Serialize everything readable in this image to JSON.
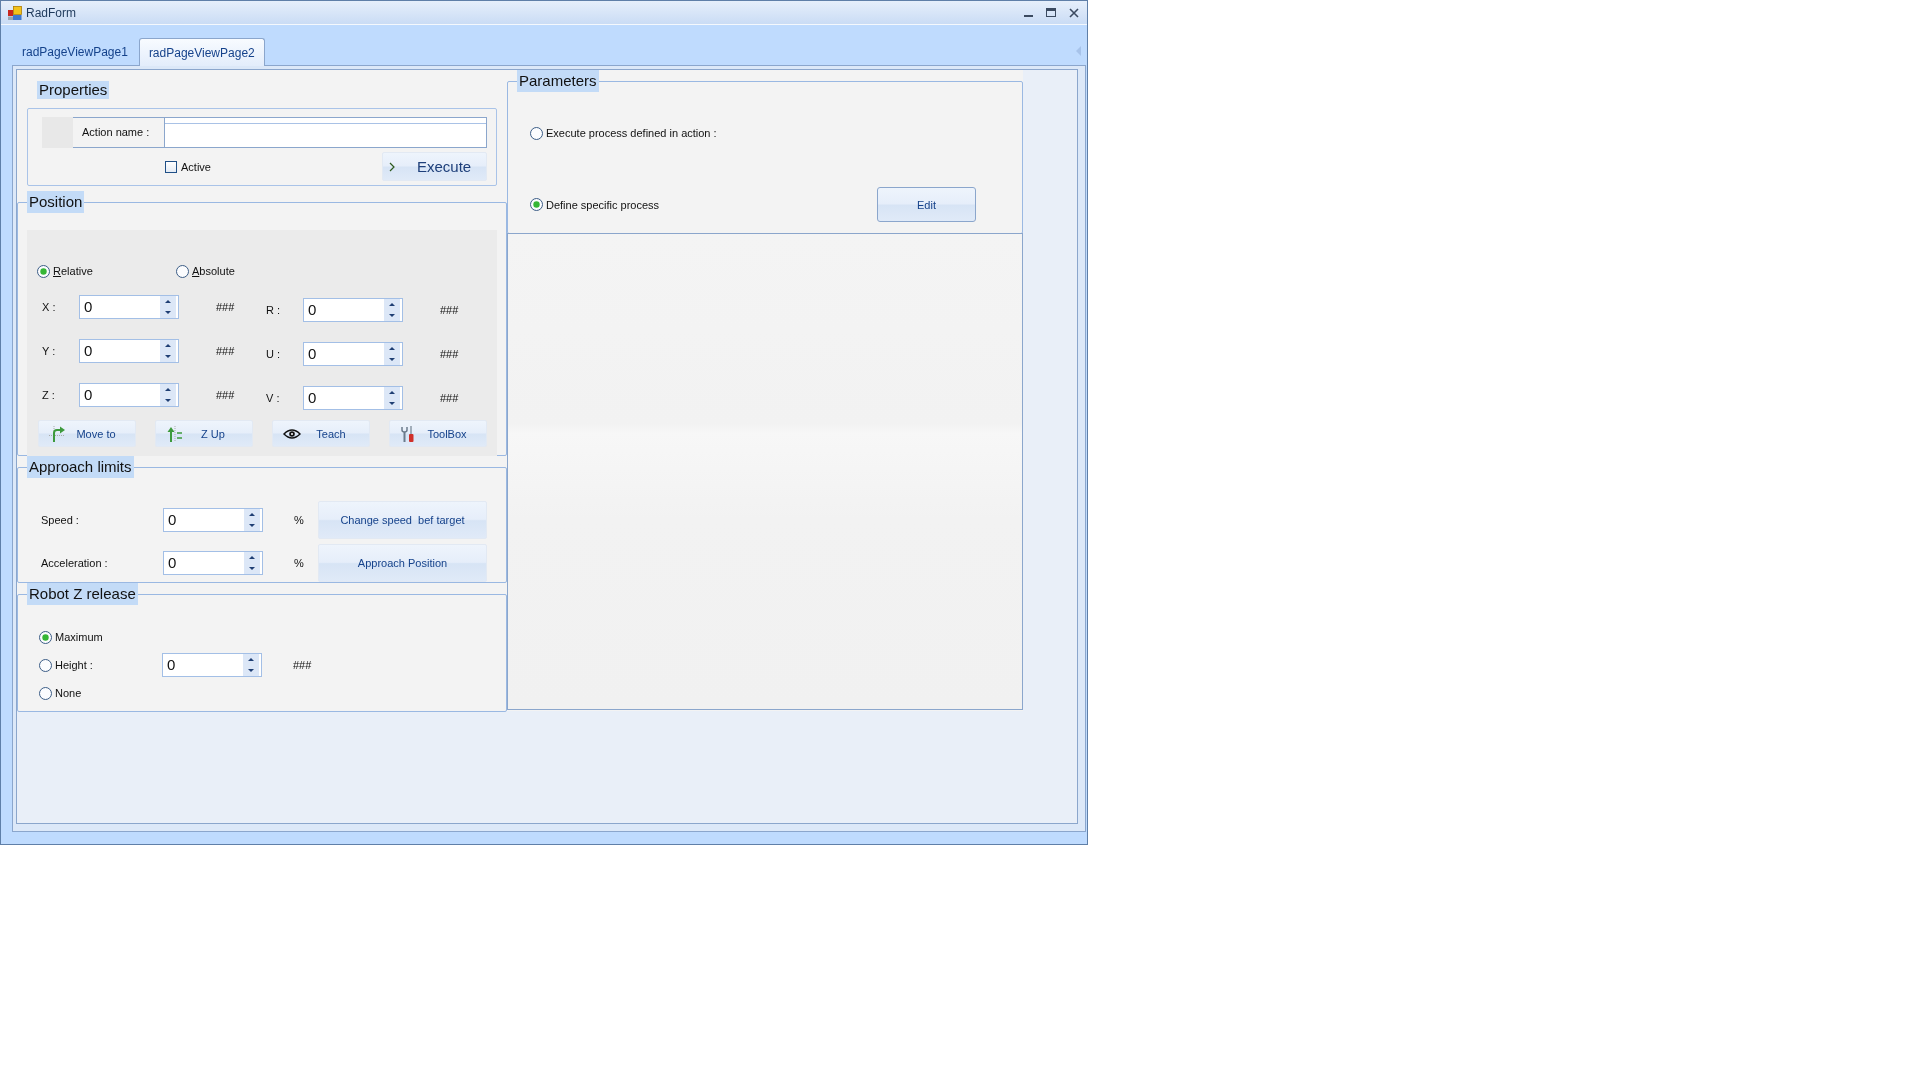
{
  "window": {
    "title": "RadForm"
  },
  "tabs": [
    {
      "label": "radPageViewPage1",
      "selected": false
    },
    {
      "label": "radPageViewPage2",
      "selected": true
    }
  ],
  "properties": {
    "title": "Properties",
    "action_name_label": "Action name :",
    "active": {
      "label": "Active",
      "checked": false
    },
    "execute_button": "Execute"
  },
  "position": {
    "title": "Position",
    "modes": [
      {
        "label": "Relative",
        "selected": true,
        "mnemonic": true
      },
      {
        "label": "Absolute",
        "selected": false,
        "mnemonic": true
      }
    ],
    "axes": [
      {
        "label": "X :",
        "value": "0",
        "unit": "###"
      },
      {
        "label": "R :",
        "value": "0",
        "unit": "###"
      },
      {
        "label": "Y :",
        "value": "0",
        "unit": "###"
      },
      {
        "label": "U :",
        "value": "0",
        "unit": "###"
      },
      {
        "label": "Z :",
        "value": "0",
        "unit": "###"
      },
      {
        "label": "V :",
        "value": "0",
        "unit": "###"
      }
    ],
    "buttons": [
      "Move to",
      "Z Up",
      "Teach",
      "ToolBox"
    ]
  },
  "approach_limits": {
    "title": "Approach limits",
    "rows": [
      {
        "label": "Speed :",
        "value": "0",
        "unit": "%",
        "button": "Change speed  bef target"
      },
      {
        "label": "Acceleration :",
        "value": "0",
        "unit": "%",
        "button": "Approach Position"
      }
    ]
  },
  "robot_z_release": {
    "title": "Robot Z release",
    "options": [
      {
        "kind": "plain",
        "label": "Maximum",
        "selected": true
      },
      {
        "kind": "spin",
        "label": "Height :",
        "selected": false,
        "value": "0",
        "unit": "###"
      },
      {
        "kind": "plain",
        "label": "None",
        "selected": false
      }
    ]
  },
  "parameters": {
    "title": "Parameters",
    "options": [
      {
        "label": "Execute process defined in action :",
        "selected": false
      },
      {
        "label": "Define specific process",
        "selected": true
      }
    ],
    "edit_button": "Edit"
  }
}
